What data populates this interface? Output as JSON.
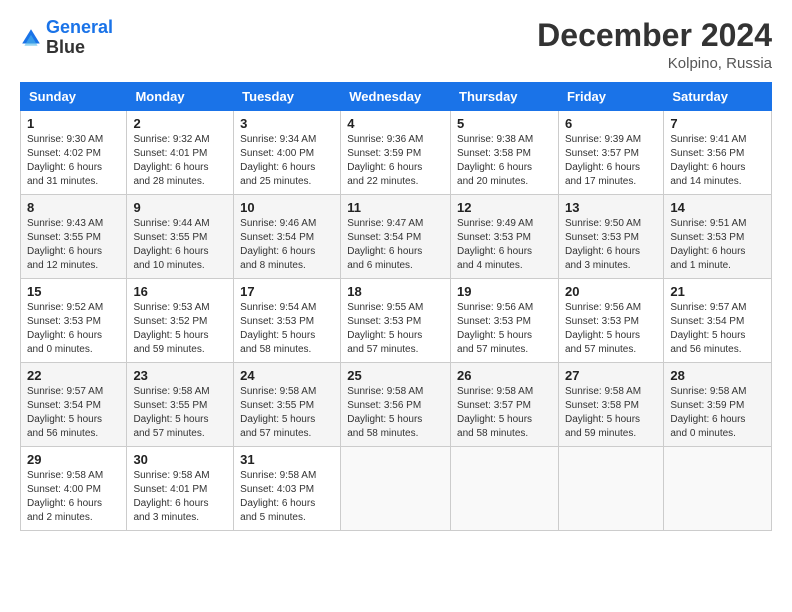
{
  "header": {
    "logo_line1": "General",
    "logo_line2": "Blue",
    "month": "December 2024",
    "location": "Kolpino, Russia"
  },
  "days_of_week": [
    "Sunday",
    "Monday",
    "Tuesday",
    "Wednesday",
    "Thursday",
    "Friday",
    "Saturday"
  ],
  "weeks": [
    [
      {
        "day": "1",
        "info": "Sunrise: 9:30 AM\nSunset: 4:02 PM\nDaylight: 6 hours\nand 31 minutes."
      },
      {
        "day": "2",
        "info": "Sunrise: 9:32 AM\nSunset: 4:01 PM\nDaylight: 6 hours\nand 28 minutes."
      },
      {
        "day": "3",
        "info": "Sunrise: 9:34 AM\nSunset: 4:00 PM\nDaylight: 6 hours\nand 25 minutes."
      },
      {
        "day": "4",
        "info": "Sunrise: 9:36 AM\nSunset: 3:59 PM\nDaylight: 6 hours\nand 22 minutes."
      },
      {
        "day": "5",
        "info": "Sunrise: 9:38 AM\nSunset: 3:58 PM\nDaylight: 6 hours\nand 20 minutes."
      },
      {
        "day": "6",
        "info": "Sunrise: 9:39 AM\nSunset: 3:57 PM\nDaylight: 6 hours\nand 17 minutes."
      },
      {
        "day": "7",
        "info": "Sunrise: 9:41 AM\nSunset: 3:56 PM\nDaylight: 6 hours\nand 14 minutes."
      }
    ],
    [
      {
        "day": "8",
        "info": "Sunrise: 9:43 AM\nSunset: 3:55 PM\nDaylight: 6 hours\nand 12 minutes."
      },
      {
        "day": "9",
        "info": "Sunrise: 9:44 AM\nSunset: 3:55 PM\nDaylight: 6 hours\nand 10 minutes."
      },
      {
        "day": "10",
        "info": "Sunrise: 9:46 AM\nSunset: 3:54 PM\nDaylight: 6 hours\nand 8 minutes."
      },
      {
        "day": "11",
        "info": "Sunrise: 9:47 AM\nSunset: 3:54 PM\nDaylight: 6 hours\nand 6 minutes."
      },
      {
        "day": "12",
        "info": "Sunrise: 9:49 AM\nSunset: 3:53 PM\nDaylight: 6 hours\nand 4 minutes."
      },
      {
        "day": "13",
        "info": "Sunrise: 9:50 AM\nSunset: 3:53 PM\nDaylight: 6 hours\nand 3 minutes."
      },
      {
        "day": "14",
        "info": "Sunrise: 9:51 AM\nSunset: 3:53 PM\nDaylight: 6 hours\nand 1 minute."
      }
    ],
    [
      {
        "day": "15",
        "info": "Sunrise: 9:52 AM\nSunset: 3:53 PM\nDaylight: 6 hours\nand 0 minutes."
      },
      {
        "day": "16",
        "info": "Sunrise: 9:53 AM\nSunset: 3:52 PM\nDaylight: 5 hours\nand 59 minutes."
      },
      {
        "day": "17",
        "info": "Sunrise: 9:54 AM\nSunset: 3:53 PM\nDaylight: 5 hours\nand 58 minutes."
      },
      {
        "day": "18",
        "info": "Sunrise: 9:55 AM\nSunset: 3:53 PM\nDaylight: 5 hours\nand 57 minutes."
      },
      {
        "day": "19",
        "info": "Sunrise: 9:56 AM\nSunset: 3:53 PM\nDaylight: 5 hours\nand 57 minutes."
      },
      {
        "day": "20",
        "info": "Sunrise: 9:56 AM\nSunset: 3:53 PM\nDaylight: 5 hours\nand 57 minutes."
      },
      {
        "day": "21",
        "info": "Sunrise: 9:57 AM\nSunset: 3:54 PM\nDaylight: 5 hours\nand 56 minutes."
      }
    ],
    [
      {
        "day": "22",
        "info": "Sunrise: 9:57 AM\nSunset: 3:54 PM\nDaylight: 5 hours\nand 56 minutes."
      },
      {
        "day": "23",
        "info": "Sunrise: 9:58 AM\nSunset: 3:55 PM\nDaylight: 5 hours\nand 57 minutes."
      },
      {
        "day": "24",
        "info": "Sunrise: 9:58 AM\nSunset: 3:55 PM\nDaylight: 5 hours\nand 57 minutes."
      },
      {
        "day": "25",
        "info": "Sunrise: 9:58 AM\nSunset: 3:56 PM\nDaylight: 5 hours\nand 58 minutes."
      },
      {
        "day": "26",
        "info": "Sunrise: 9:58 AM\nSunset: 3:57 PM\nDaylight: 5 hours\nand 58 minutes."
      },
      {
        "day": "27",
        "info": "Sunrise: 9:58 AM\nSunset: 3:58 PM\nDaylight: 5 hours\nand 59 minutes."
      },
      {
        "day": "28",
        "info": "Sunrise: 9:58 AM\nSunset: 3:59 PM\nDaylight: 6 hours\nand 0 minutes."
      }
    ],
    [
      {
        "day": "29",
        "info": "Sunrise: 9:58 AM\nSunset: 4:00 PM\nDaylight: 6 hours\nand 2 minutes."
      },
      {
        "day": "30",
        "info": "Sunrise: 9:58 AM\nSunset: 4:01 PM\nDaylight: 6 hours\nand 3 minutes."
      },
      {
        "day": "31",
        "info": "Sunrise: 9:58 AM\nSunset: 4:03 PM\nDaylight: 6 hours\nand 5 minutes."
      },
      null,
      null,
      null,
      null
    ]
  ]
}
